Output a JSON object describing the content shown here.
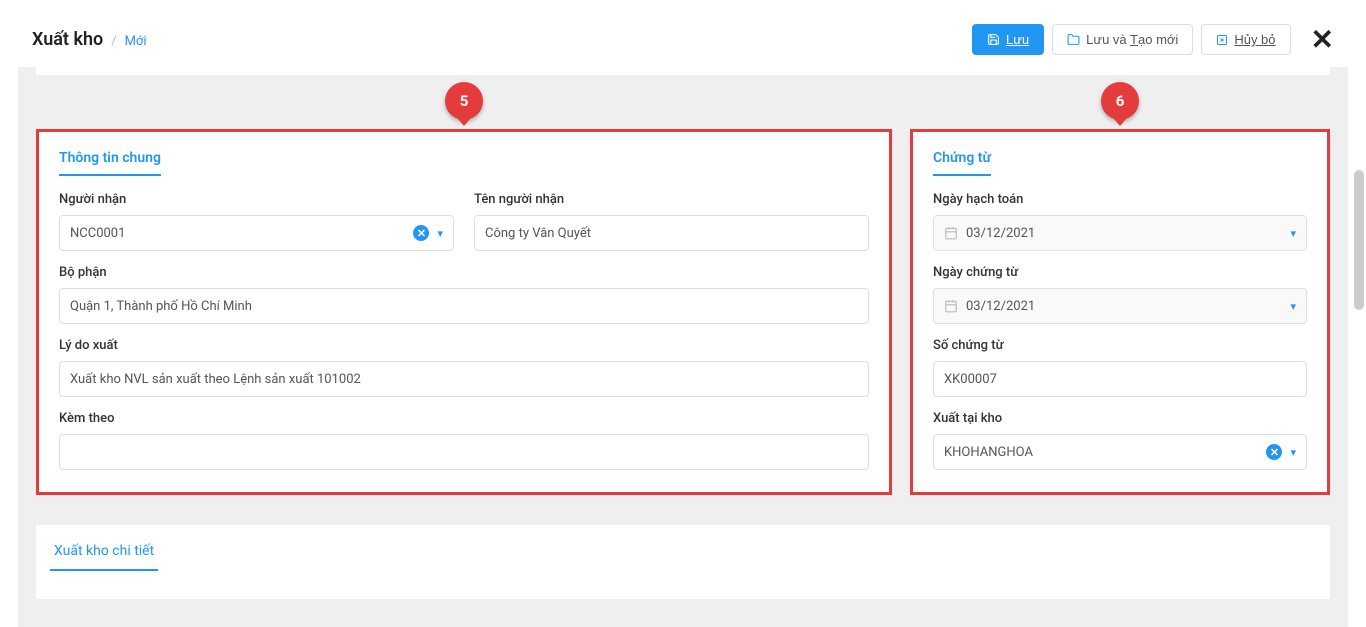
{
  "header": {
    "title": "Xuất kho",
    "subtitle": "Mới",
    "save_label": "Lưu",
    "save_new_label": "Lưu và Tạo mới",
    "cancel_label": "Hủy bỏ"
  },
  "badges": {
    "left": "5",
    "right": "6"
  },
  "left_panel": {
    "tab": "Thông tin chung",
    "recipient_label": "Người nhận",
    "recipient_value": "NCC0001",
    "recipient_name_label": "Tên người nhận",
    "recipient_name_value": "Công ty Vân Quyết",
    "department_label": "Bộ phận",
    "department_value": "Quận 1, Thành phố Hồ Chí Minh",
    "reason_label": "Lý do xuất",
    "reason_value": "Xuất kho NVL sản xuất theo Lệnh sản xuất 101002",
    "attach_label": "Kèm theo",
    "attach_value": ""
  },
  "right_panel": {
    "tab": "Chứng từ",
    "acc_date_label": "Ngày hạch toán",
    "acc_date_value": "03/12/2021",
    "doc_date_label": "Ngày chứng từ",
    "doc_date_value": "03/12/2021",
    "doc_no_label": "Số chứng từ",
    "doc_no_value": "XK00007",
    "warehouse_label": "Xuất tại kho",
    "warehouse_value": "KHOHANGHOA"
  },
  "detail": {
    "tab": "Xuất kho chi tiết"
  }
}
